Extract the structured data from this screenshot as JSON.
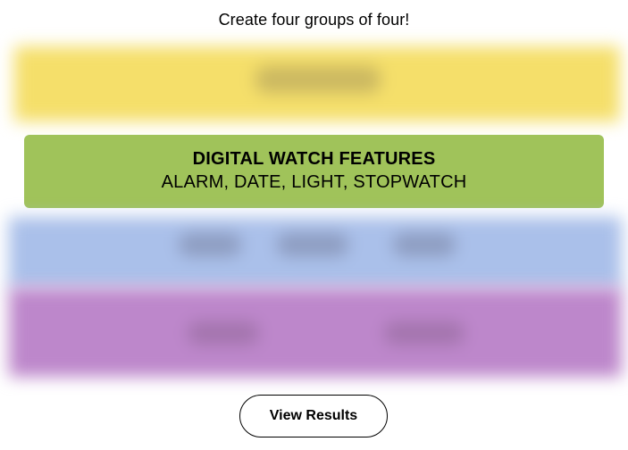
{
  "prompt": "Create four groups of four!",
  "groups": [
    {
      "state": "hidden",
      "color": "#f5df6a"
    },
    {
      "state": "solved",
      "color": "#a0c35a",
      "title": "DIGITAL WATCH FEATURES",
      "words": "ALARM, DATE, LIGHT, STOPWATCH"
    },
    {
      "state": "hidden",
      "color": "#aac0ea"
    },
    {
      "state": "hidden",
      "color": "#bd87cb"
    }
  ],
  "actions": {
    "view_results_label": "View Results"
  }
}
